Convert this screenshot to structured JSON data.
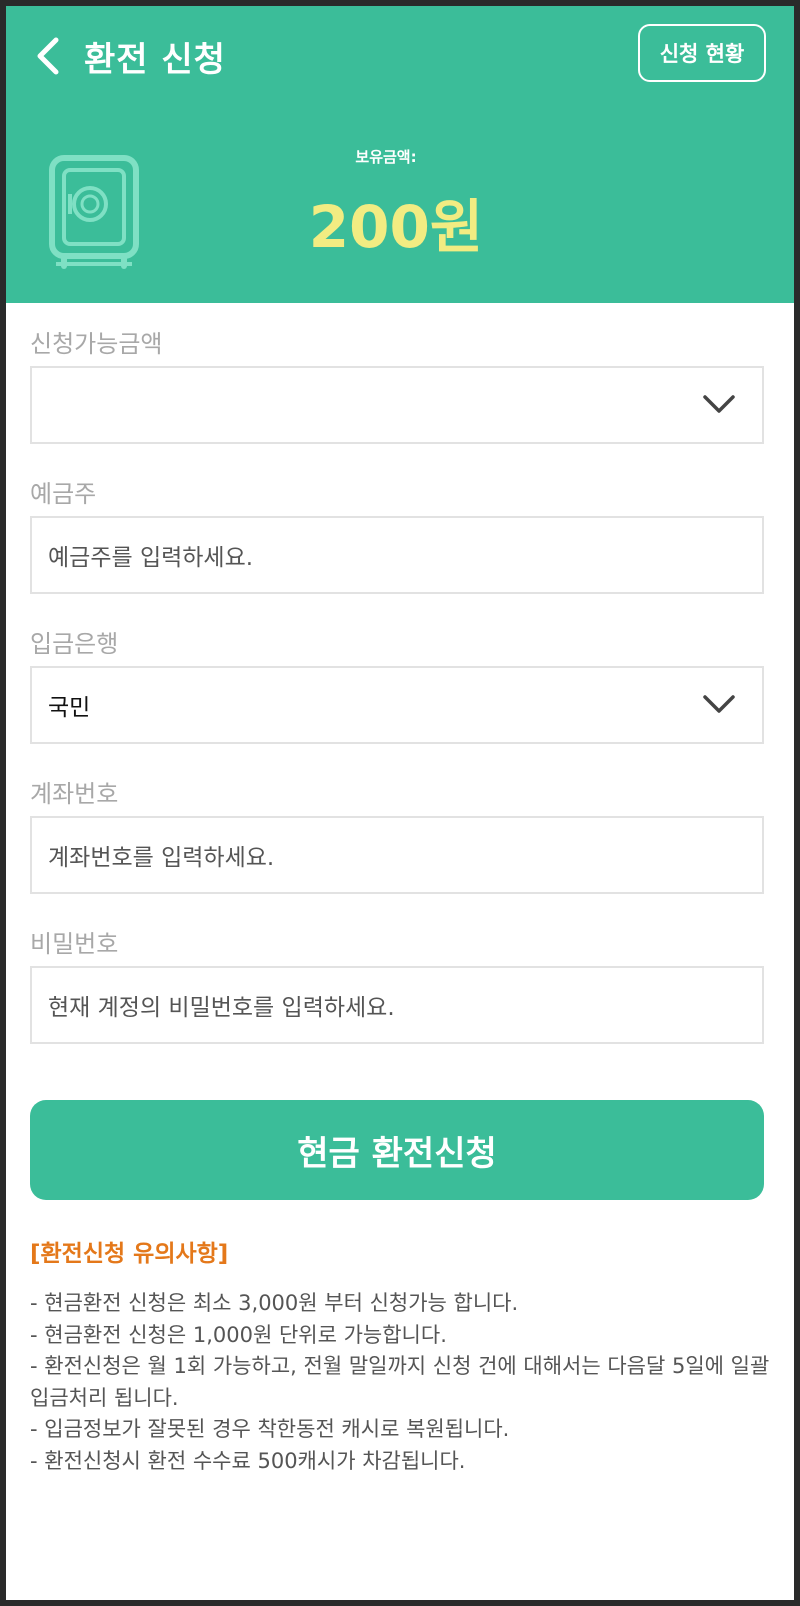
{
  "header": {
    "title": "환전 신청",
    "status_button": "신청 현황",
    "balance_label": "보유금액:",
    "balance_value": "200원",
    "icons": {
      "back": "chevron-left-icon",
      "safe": "safe-icon"
    },
    "colors": {
      "brand": "#3bbd99",
      "balance": "#f2ec82"
    }
  },
  "form": {
    "amount": {
      "label": "신청가능금액",
      "value": ""
    },
    "depositor": {
      "label": "예금주",
      "placeholder": "예금주를 입력하세요."
    },
    "bank": {
      "label": "입금은행",
      "value": "국민"
    },
    "account": {
      "label": "계좌번호",
      "placeholder": "계좌번호를 입력하세요."
    },
    "password": {
      "label": "비밀번호",
      "placeholder": "현재 계정의 비밀번호를 입력하세요."
    }
  },
  "submit_label": "현금 환전신청",
  "notice": {
    "title": "[환전신청 유의사항]",
    "items": [
      "- 현금환전 신청은 최소 3,000원 부터 신청가능 합니다.",
      "- 현금환전 신청은 1,000원 단위로 가능합니다.",
      "- 환전신청은 월 1회 가능하고, 전월 말일까지 신청 건에 대해서는 다음달 5일에 일괄 입금처리 됩니다.",
      "- 입금정보가 잘못된 경우 착한동전 캐시로 복원됩니다.",
      "- 환전신청시 환전 수수료 500캐시가 차감됩니다."
    ],
    "colors": {
      "title": "#e4781a"
    }
  }
}
